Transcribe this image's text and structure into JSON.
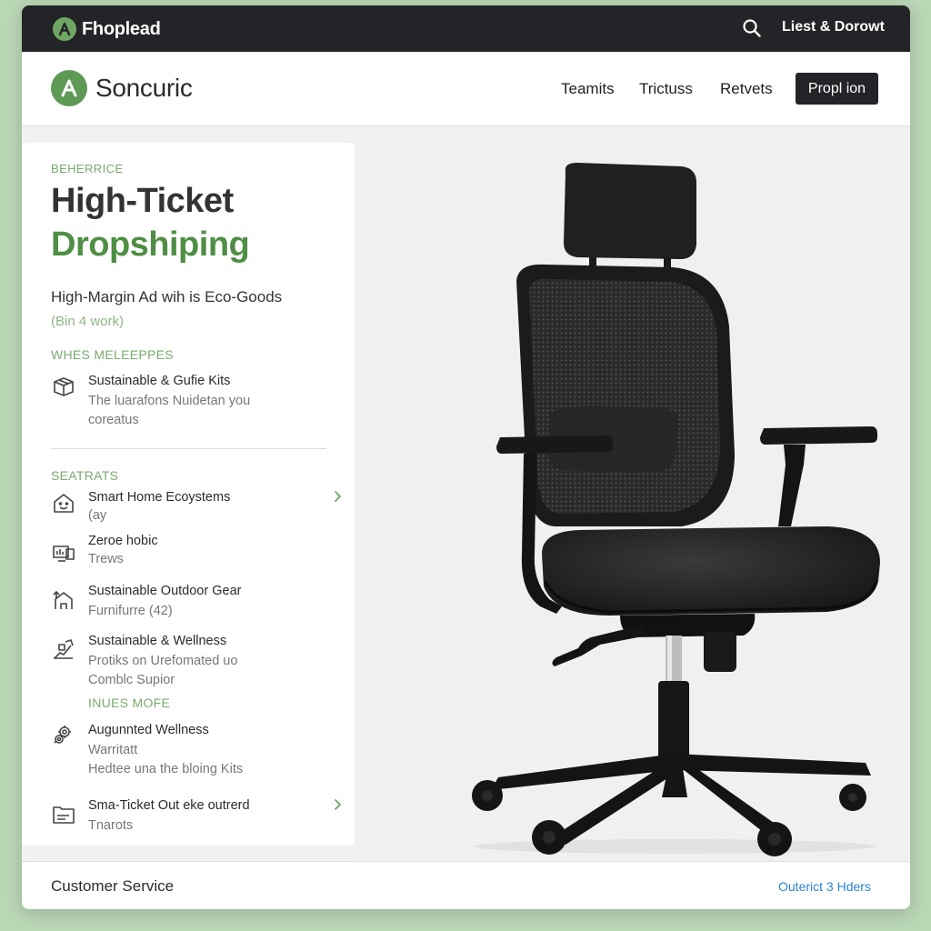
{
  "topbar": {
    "brand": "Fhoplead",
    "brand_logo_letter": "A",
    "account_link": "Liest & Dorowt",
    "search_icon": "search-icon"
  },
  "header": {
    "site_name": "Soncuric",
    "site_logo_letter": "A",
    "nav": [
      "Teamits",
      "Trictuss",
      "Retvets"
    ],
    "cta": "Propl ion"
  },
  "hero": {
    "eyebrow": "BEHERRICE",
    "title_line1": "High-Ticket",
    "title_line2": "Dropshiping",
    "subtitle": "High-Margin Ad wih is Eco-Goods",
    "subnote": "(Bin 4 work)"
  },
  "section1": {
    "label": "WHES MELEEPPES",
    "items": [
      {
        "icon": "box-icon",
        "title": "Sustainable & Gufie Kits",
        "desc": [
          "The luarafons Nuidetan you",
          "coreatus"
        ]
      }
    ]
  },
  "section2": {
    "label": "SEATRATS",
    "items": [
      {
        "icon": "smart-home-icon",
        "title": "Smart Home Ecoystems",
        "desc": [
          "(ay"
        ],
        "chevron": true
      },
      {
        "icon": "monitor-icon",
        "title": "Zeroe hobic",
        "desc": [
          "Trews"
        ]
      },
      {
        "icon": "outdoor-home-icon",
        "title": "Sustainable Outdoor Gear",
        "desc": [
          "Furnifurre (42)"
        ]
      },
      {
        "icon": "wellness-icon",
        "title": "Sustainable & Wellness",
        "desc": [
          "Protiks on Urefomated uo",
          "Comblc Supior"
        ]
      }
    ]
  },
  "section3": {
    "label": "INUES MOFE",
    "items": [
      {
        "icon": "gears-icon",
        "title": "Augunnted Wellness",
        "desc": [
          "Warritatt",
          "Hedtee una the bloing Kits"
        ]
      },
      {
        "icon": "ticket-box-icon",
        "title": "Sma-Ticket Out eke outrerd",
        "desc": [
          "Tnarots"
        ],
        "chevron": true
      }
    ]
  },
  "product": {
    "image": "office-chair-product-photo"
  },
  "footer": {
    "left": "Customer Service",
    "right_link": "Outerict 3 Hders"
  },
  "colors": {
    "accent_green": "#4f8e44",
    "label_green": "#7aab70",
    "dark_bar": "#232427",
    "link_blue": "#2c84d1",
    "page_bg": "#b9d6b5"
  }
}
